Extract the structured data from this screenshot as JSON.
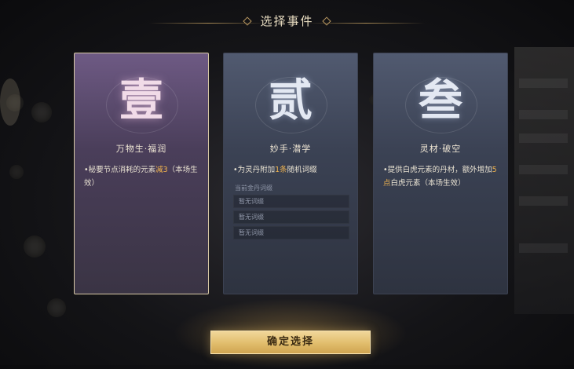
{
  "title": "选择事件",
  "cards": [
    {
      "char": "壹",
      "name": "万物生·福润",
      "desc_prefix": "•秘要节点消耗的元素",
      "desc_highlight": "减3",
      "desc_suffix": "（本场生效）",
      "selected": true
    },
    {
      "char": "贰",
      "name": "妙手·潜学",
      "desc_prefix": "•为灵丹附加",
      "desc_highlight": "1条",
      "desc_suffix": "随机词缀",
      "sub_label": "当前金丹词缀",
      "slots": [
        "暂无词缀",
        "暂无词缀",
        "暂无词缀"
      ],
      "selected": false
    },
    {
      "char": "叁",
      "name": "灵材·破空",
      "desc_prefix": "•提供白虎元素的丹材，额外增加",
      "desc_highlight": "5点",
      "desc_suffix": "白虎元素（本场生效）",
      "selected": false
    }
  ],
  "confirm_label": "确定选择",
  "colors": {
    "accent_gold": "#f0b34f",
    "selected_card": "#6e5a84",
    "plain_card": "#515a70"
  }
}
